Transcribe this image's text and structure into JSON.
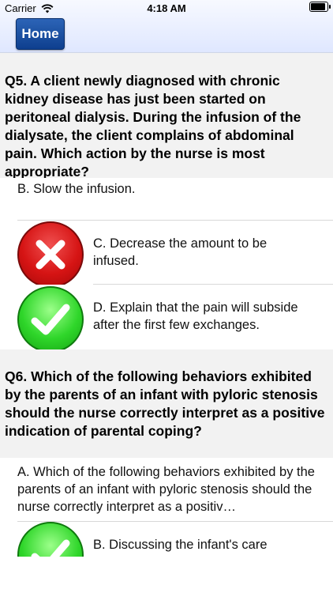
{
  "status_bar": {
    "carrier": "Carrier",
    "time": "4:18 AM",
    "battery_level": 1.0
  },
  "nav": {
    "home_label": "Home"
  },
  "q5": {
    "question": "Q5. A client newly diagnosed with chronic kidney disease has just been started on peritoneal dialysis. During the infusion of the dialysate, the client complains of abdominal pain. Which action by the nurse is most appropriate?",
    "options": [
      {
        "text": "B. Slow the infusion.",
        "mark": "none"
      },
      {
        "text": "C. Decrease the amount to be infused.",
        "mark": "wrong"
      },
      {
        "text": "D. Explain that the pain will subside after the first few exchanges.",
        "mark": "correct"
      }
    ]
  },
  "q6": {
    "question": "Q6. Which of the following behaviors exhibited by the parents of an infant with pyloric stenosis should the nurse correctly interpret as a positive indication of parental coping?",
    "options": [
      {
        "text": "A. Which of the following behaviors exhibited by the parents of an infant with pyloric stenosis should the nurse correctly interpret as a positiv…",
        "mark": "none"
      },
      {
        "text": "B. Discussing the infant's care",
        "mark": "correct"
      }
    ]
  },
  "icons": {
    "wrong": "x-mark-icon",
    "correct": "check-mark-icon"
  },
  "colors": {
    "nav_button": "#1a4fa0",
    "wrong_badge": "#d61414",
    "correct_badge": "#2fd62a",
    "question_bg": "#f2f2f2"
  }
}
